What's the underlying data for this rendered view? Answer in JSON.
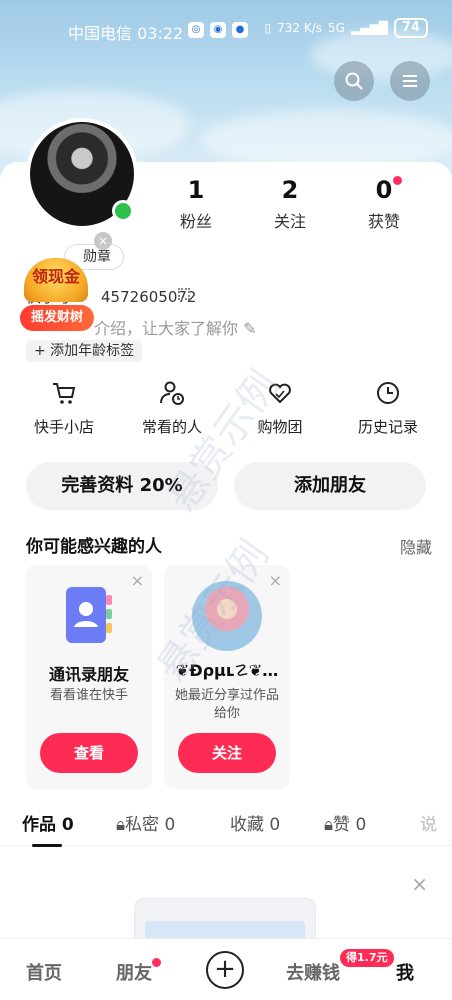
{
  "status_bar": {
    "carrier": "中国电信",
    "time": "03:22",
    "net_speed": "732 K/s",
    "signal": "5G",
    "battery": "74"
  },
  "profile": {
    "fans_count": "1",
    "fans_label": "粉丝",
    "following_count": "2",
    "following_label": "关注",
    "likes_count": "0",
    "likes_label": "获赞",
    "medal_label": "勋章",
    "kuaishou_id_label": "快手号",
    "kuaishou_id": "4572605072",
    "intro_placeholder": "介绍，让大家了解你",
    "age_tag_label": "+ 添加年龄标签",
    "promo_gold": "领现金",
    "promo_tree": "摇发财树"
  },
  "tools": [
    {
      "label": "快手小店",
      "icon": "cart-icon"
    },
    {
      "label": "常看的人",
      "icon": "person-clock-icon"
    },
    {
      "label": "购物团",
      "icon": "heart-group-icon"
    },
    {
      "label": "历史记录",
      "icon": "clock-icon"
    }
  ],
  "actions": {
    "complete_profile": "完善资料 20%",
    "add_friends": "添加朋友"
  },
  "recommend": {
    "title": "你可能感兴趣的人",
    "hide_label": "隐藏",
    "cards": [
      {
        "name": "通讯录朋友",
        "subtitle": "看看谁在快手",
        "button": "查看"
      },
      {
        "name": "❦Ɖρμʟ☡❦…",
        "subtitle": "她最近分享过作品给你",
        "button": "关注"
      }
    ]
  },
  "tabs": [
    {
      "label": "作品",
      "count": "0"
    },
    {
      "label": "私密",
      "count": "0"
    },
    {
      "label": "收藏",
      "count": "0"
    },
    {
      "label": "赞",
      "count": "0"
    },
    {
      "label": "说",
      "count": ""
    }
  ],
  "bottom_nav": {
    "home": "首页",
    "friends": "朋友",
    "earn": "去赚钱",
    "earn_badge": "得1.7元",
    "me": "我"
  },
  "watermark": "悬赏示例",
  "colors": {
    "accent": "#fe2c55",
    "online": "#2dc14a",
    "promo": "#ff3b2f"
  }
}
